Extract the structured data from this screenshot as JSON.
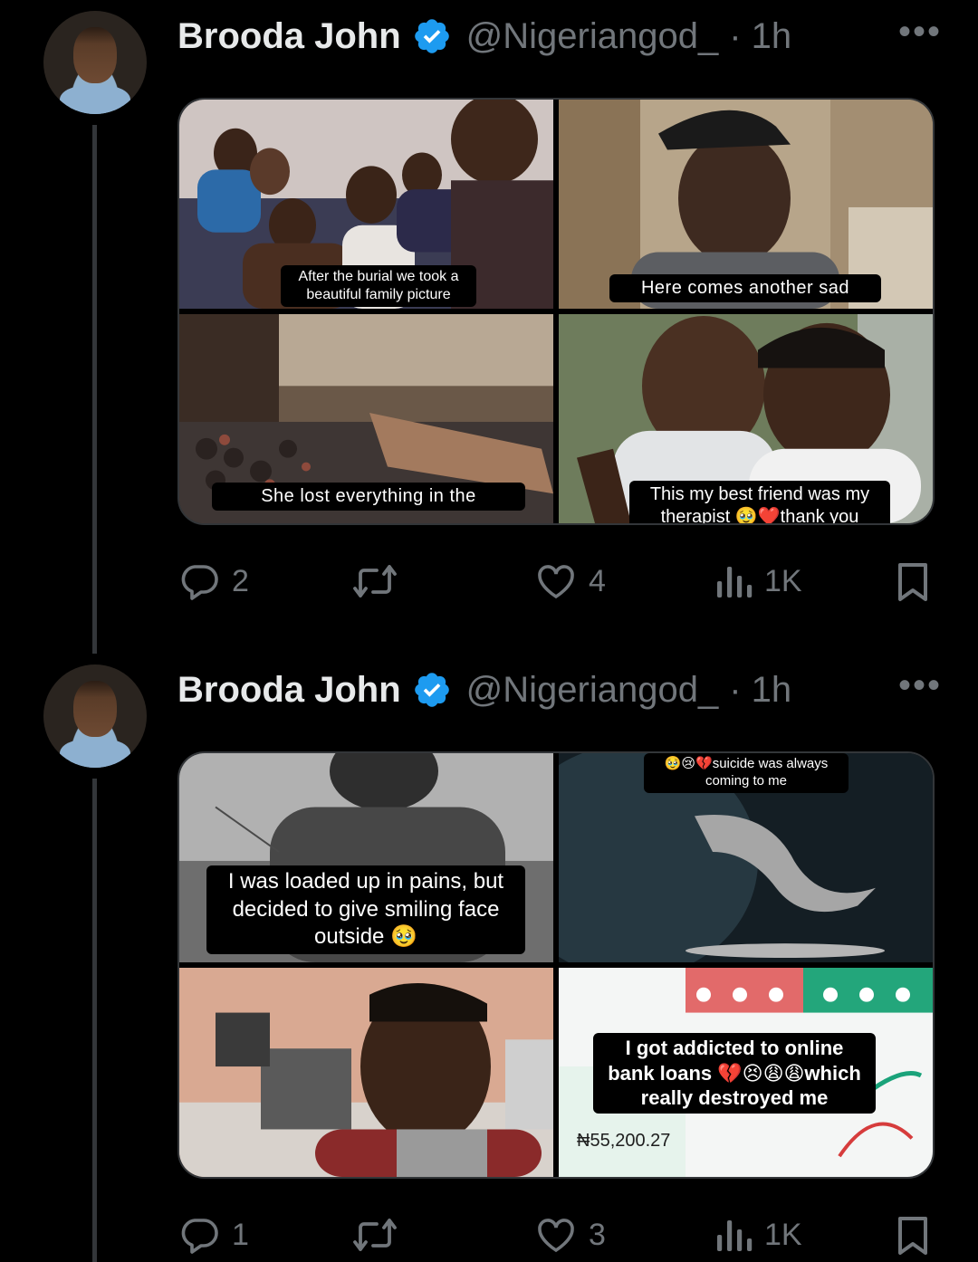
{
  "tweets": [
    {
      "author": {
        "name": "Brooda John",
        "handle": "@Nigeriangod_",
        "time": "· 1h"
      },
      "media": [
        {
          "caption": "After the burial we took a beautiful family picture",
          "colors": [
            "#8a6a52",
            "#3b2a22",
            "#c9c2c4"
          ]
        },
        {
          "caption": "Here comes another sad",
          "colors": [
            "#9c8a6e",
            "#3e2c22",
            "#c2b49c"
          ]
        },
        {
          "caption": "She lost everything in the",
          "colors": [
            "#6a5a4c",
            "#2e2a28",
            "#a59a8c"
          ]
        },
        {
          "caption": "This my best friend was my therapist 🥹❤️thank you",
          "colors": [
            "#6c7e60",
            "#2e241c",
            "#d0d4d8"
          ]
        }
      ],
      "stats": {
        "replies": "2",
        "likes": "4",
        "views": "1K"
      }
    },
    {
      "author": {
        "name": "Brooda John",
        "handle": "@Nigeriangod_",
        "time": "· 1h"
      },
      "media": [
        {
          "caption": "I was loaded up in pains, but decided to give smiling face outside 🥹",
          "colors": [
            "#8d8d8d",
            "#3a3a3a",
            "#b7b7b7"
          ]
        },
        {
          "caption": "🥹😢💔suicide was always coming to me",
          "colors": [
            "#1b2a33",
            "#0f171c",
            "#4e6775"
          ]
        },
        {
          "caption": "",
          "colors": [
            "#c28f7a",
            "#3a2418",
            "#d6cdc6"
          ]
        },
        {
          "caption": "I got addicted to online bank loans 💔😣😩😩which really destroyed me",
          "amount": "₦55,200.27",
          "colors": [
            "#e4eee8",
            "#d95a5a",
            "#1aa37a"
          ]
        }
      ],
      "stats": {
        "replies": "1",
        "likes": "3",
        "views": "1K"
      }
    }
  ],
  "icons": [
    "more-options-icon",
    "verified-badge-icon",
    "reply-icon",
    "retweet-icon",
    "like-icon",
    "views-icon",
    "bookmark-icon"
  ],
  "colors": {
    "background": "#000000",
    "text": "#e7e9ea",
    "muted": "#71767b",
    "verified": "#1d9bf0",
    "border": "#333639"
  }
}
